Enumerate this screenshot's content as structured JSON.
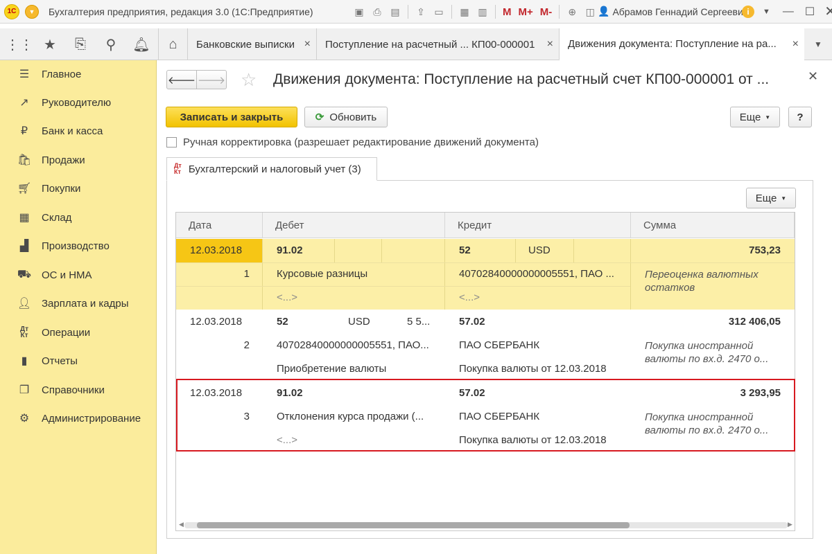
{
  "app": {
    "title": "Бухгалтерия предприятия, редакция 3.0  (1С:Предприятие)",
    "logo_text": "1С",
    "user": "Абрамов Геннадий Сергеевич",
    "toolbar_m": [
      "M",
      "M+",
      "M-"
    ]
  },
  "tabs": [
    {
      "label": "Банковские выписки",
      "close": "×"
    },
    {
      "label": "Поступление на расчетный ...  КП00-000001",
      "close": "×"
    },
    {
      "label": "Движения документа: Поступление на ра...",
      "close": "×"
    }
  ],
  "sidebar": {
    "items": [
      {
        "label": "Главное",
        "icon": "menu-icon"
      },
      {
        "label": "Руководителю",
        "icon": "trend-icon"
      },
      {
        "label": "Банк и касса",
        "icon": "ruble-icon"
      },
      {
        "label": "Продажи",
        "icon": "bag-icon"
      },
      {
        "label": "Покупки",
        "icon": "cart-icon"
      },
      {
        "label": "Склад",
        "icon": "warehouse-icon"
      },
      {
        "label": "Производство",
        "icon": "factory-icon"
      },
      {
        "label": "ОС и НМА",
        "icon": "truck-icon"
      },
      {
        "label": "Зарплата и кадры",
        "icon": "person-icon"
      },
      {
        "label": "Операции",
        "icon": "dt-kt-icon"
      },
      {
        "label": "Отчеты",
        "icon": "chart-icon"
      },
      {
        "label": "Справочники",
        "icon": "book-icon"
      },
      {
        "label": "Администрирование",
        "icon": "gear-icon"
      }
    ]
  },
  "document": {
    "title": "Движения документа: Поступление на расчетный счет КП00-000001 от ...",
    "save_close": "Записать и закрыть",
    "refresh": "Обновить",
    "more": "Еще",
    "help": "?",
    "manual_label": "Ручная корректировка (разрешает редактирование движений документа)",
    "subtab_label": "Бухгалтерский и налоговый учет (3)",
    "subtab_icon_top": "Дт",
    "subtab_icon_bottom": "Кт",
    "table_more": "Еще"
  },
  "table": {
    "columns": [
      "Дата",
      "Дебет",
      "Кредит",
      "Сумма"
    ],
    "rows": [
      {
        "date": "12.03.2018",
        "num": "1",
        "debit_account": "91.02",
        "debit_sub1": "",
        "debit_sub2": "",
        "debit_line2": "Курсовые разницы",
        "debit_line3": "<...>",
        "credit_account": "52",
        "credit_currency": "USD",
        "credit_line2": "40702840000000005551, ПАО ...",
        "credit_line3": "<...>",
        "sum": "753,23",
        "sum_comment": "Переоценка валютных остатков"
      },
      {
        "date": "12.03.2018",
        "num": "2",
        "debit_account": "52",
        "debit_sub1": "USD",
        "debit_sub2": "5 5...",
        "debit_line2": "40702840000000005551, ПАО...",
        "debit_line3": "Приобретение валюты",
        "credit_account": "57.02",
        "credit_currency": "",
        "credit_line2": "ПАО СБЕРБАНК",
        "credit_line3": "Покупка валюты от 12.03.2018",
        "sum": "312 406,05",
        "sum_comment": "Покупка иностранной валюты по вх.д. 2470 о..."
      },
      {
        "date": "12.03.2018",
        "num": "3",
        "debit_account": "91.02",
        "debit_sub1": "",
        "debit_sub2": "",
        "debit_line2": "Отклонения курса продажи (...",
        "debit_line3": "<...>",
        "credit_account": "57.02",
        "credit_currency": "",
        "credit_line2": "ПАО СБЕРБАНК",
        "credit_line3": "Покупка валюты от 12.03.2018",
        "sum": "3 293,95",
        "sum_comment": "Покупка иностранной валюты по вх.д. 2470 о..."
      }
    ]
  },
  "colors": {
    "sidebar_bg": "#fbec9c",
    "selected_row": "#fcefa7",
    "selected_cell": "#f6c615",
    "primary_button": "#f2c200",
    "highlight_border": "#d71920"
  }
}
